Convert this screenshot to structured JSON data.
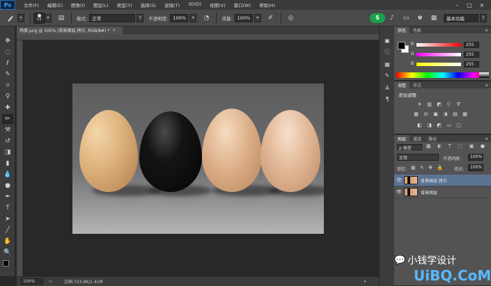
{
  "app": {
    "logo": "Ps",
    "menu": [
      "文件(F)",
      "编辑(E)",
      "图像(I)",
      "图层(L)",
      "类型(Y)",
      "选择(S)",
      "滤镜(T)",
      "3D(D)",
      "视图(V)",
      "窗口(W)",
      "帮助(H)"
    ],
    "window_controls": [
      "–",
      "□",
      "×"
    ]
  },
  "options": {
    "brush_size": "13",
    "mode_label": "模式:",
    "mode_value": "正常",
    "opacity_label": "不透明度:",
    "opacity_value": "100%",
    "flow_label": "流量:",
    "flow_value": "100%",
    "badge": "S",
    "workspace": "基本功能"
  },
  "document": {
    "tab_title": "鸡蛋.png @ 100% (背景图层 拷贝, RGB/8#) *",
    "tab_close": "×",
    "zoom": "100%",
    "doc_info": "文档:723.8K/1.41M"
  },
  "color_panel": {
    "tabs": [
      "颜色",
      "色板"
    ],
    "channels": [
      {
        "label": "R",
        "value": "255",
        "gradient": "#ff0000"
      },
      {
        "label": "G",
        "value": "255",
        "gradient": "#00ff00"
      },
      {
        "label": "B",
        "value": "255",
        "gradient": "#0000ff"
      }
    ]
  },
  "adjust_panel": {
    "tabs": [
      "调整",
      "样式"
    ],
    "title": "添加调整",
    "row1": [
      "☀",
      "▥",
      "◩",
      "▽",
      "∇"
    ],
    "row2": [
      "▦",
      "⚖",
      "▣",
      "◑",
      "▤",
      "▦"
    ],
    "row3": [
      "◧",
      "◨",
      "◩",
      "▭",
      "▢"
    ]
  },
  "layers_panel": {
    "tabs": [
      "图层",
      "通道",
      "路径"
    ],
    "filter": "ρ 类型",
    "blend_mode": "正常",
    "opacity_label": "不透明度:",
    "opacity_value": "100%",
    "lock_label": "锁定:",
    "fill_label": "填充:",
    "fill_value": "100%",
    "layers": [
      {
        "name": "背景图层 拷贝",
        "selected": true
      },
      {
        "name": "背景图层",
        "selected": false
      }
    ]
  },
  "watermarks": {
    "wechat": "小钱学设计",
    "site": "UiBQ.CoM"
  },
  "colors": {
    "foreground": "#000000",
    "background": "#ffffff",
    "accent_selected": "#5b7494"
  }
}
